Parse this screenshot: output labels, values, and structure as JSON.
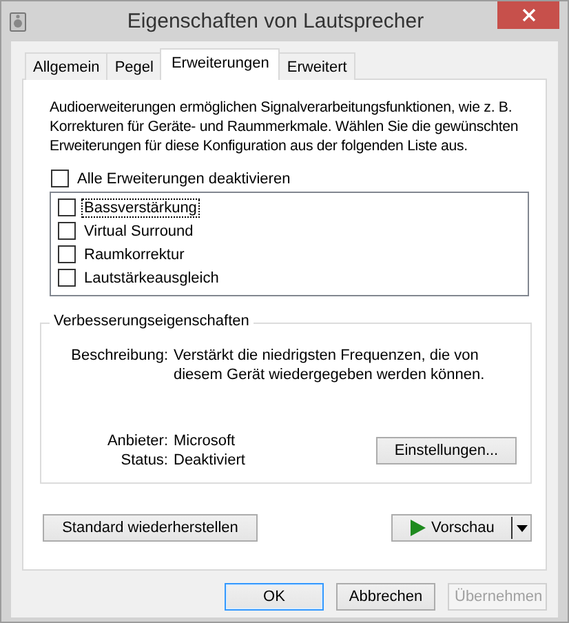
{
  "window": {
    "title": "Eigenschaften von Lautsprecher"
  },
  "tabs": [
    {
      "label": "Allgemein",
      "selected": false
    },
    {
      "label": "Pegel",
      "selected": false
    },
    {
      "label": "Erweiterungen",
      "selected": true
    },
    {
      "label": "Erweitert",
      "selected": false
    }
  ],
  "intro": "Audioerweiterungen ermöglichen Signalverarbeitungsfunktionen, wie z. B. Korrekturen für Geräte- und Raummerkmale. Wählen Sie die gewünschten Erweiterungen für diese Konfiguration aus der folgenden Liste aus.",
  "disable_all": {
    "label": "Alle Erweiterungen deaktivieren",
    "checked": false
  },
  "enhancements": [
    {
      "label": "Bassverstärkung",
      "checked": false,
      "focused": true
    },
    {
      "label": "Virtual Surround",
      "checked": false,
      "focused": false
    },
    {
      "label": "Raumkorrektur",
      "checked": false,
      "focused": false
    },
    {
      "label": "Lautstärkeausgleich",
      "checked": false,
      "focused": false
    }
  ],
  "properties": {
    "title": "Verbesserungseigenschaften",
    "fields": [
      {
        "label": "Beschreibung:",
        "value": "Verstärkt die niedrigsten Frequenzen, die von diesem Gerät wiedergegeben werden können."
      },
      {
        "label": "Anbieter:",
        "value": "Microsoft"
      },
      {
        "label": "Status:",
        "value": "Deaktiviert"
      }
    ],
    "settings_button": "Einstellungen..."
  },
  "restore_button": "Standard wiederherstellen",
  "preview_button": "Vorschau",
  "buttons": [
    {
      "label": "OK",
      "default": true,
      "disabled": false
    },
    {
      "label": "Abbrechen",
      "default": false,
      "disabled": false
    },
    {
      "label": "Übernehmen",
      "default": false,
      "disabled": true
    }
  ]
}
